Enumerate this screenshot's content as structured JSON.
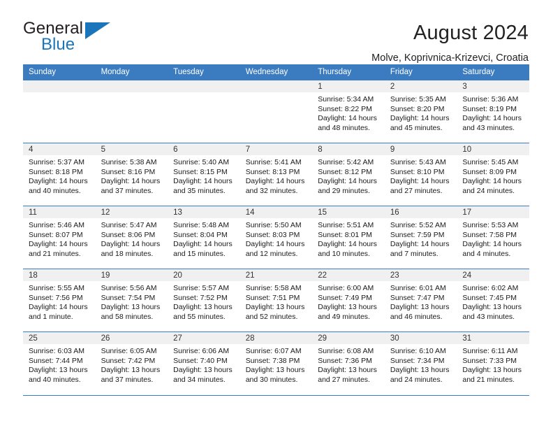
{
  "brand": {
    "name_part1": "General",
    "name_part2": "Blue",
    "triangle_color": "#1b75bb"
  },
  "header": {
    "title": "August 2024",
    "subtitle": "Molve, Koprivnica-Krizevci, Croatia"
  },
  "theme": {
    "header_row_bg": "#3b7cc0",
    "daynum_bg": "#f0f0f0",
    "grid_line": "#3b7cc0"
  },
  "weekday_headers": [
    "Sunday",
    "Monday",
    "Tuesday",
    "Wednesday",
    "Thursday",
    "Friday",
    "Saturday"
  ],
  "weeks": [
    [
      {
        "day": "",
        "sunrise": "",
        "sunset": "",
        "daylight1": "",
        "daylight2": ""
      },
      {
        "day": "",
        "sunrise": "",
        "sunset": "",
        "daylight1": "",
        "daylight2": ""
      },
      {
        "day": "",
        "sunrise": "",
        "sunset": "",
        "daylight1": "",
        "daylight2": ""
      },
      {
        "day": "",
        "sunrise": "",
        "sunset": "",
        "daylight1": "",
        "daylight2": ""
      },
      {
        "day": "1",
        "sunrise": "Sunrise: 5:34 AM",
        "sunset": "Sunset: 8:22 PM",
        "daylight1": "Daylight: 14 hours",
        "daylight2": "and 48 minutes."
      },
      {
        "day": "2",
        "sunrise": "Sunrise: 5:35 AM",
        "sunset": "Sunset: 8:20 PM",
        "daylight1": "Daylight: 14 hours",
        "daylight2": "and 45 minutes."
      },
      {
        "day": "3",
        "sunrise": "Sunrise: 5:36 AM",
        "sunset": "Sunset: 8:19 PM",
        "daylight1": "Daylight: 14 hours",
        "daylight2": "and 43 minutes."
      }
    ],
    [
      {
        "day": "4",
        "sunrise": "Sunrise: 5:37 AM",
        "sunset": "Sunset: 8:18 PM",
        "daylight1": "Daylight: 14 hours",
        "daylight2": "and 40 minutes."
      },
      {
        "day": "5",
        "sunrise": "Sunrise: 5:38 AM",
        "sunset": "Sunset: 8:16 PM",
        "daylight1": "Daylight: 14 hours",
        "daylight2": "and 37 minutes."
      },
      {
        "day": "6",
        "sunrise": "Sunrise: 5:40 AM",
        "sunset": "Sunset: 8:15 PM",
        "daylight1": "Daylight: 14 hours",
        "daylight2": "and 35 minutes."
      },
      {
        "day": "7",
        "sunrise": "Sunrise: 5:41 AM",
        "sunset": "Sunset: 8:13 PM",
        "daylight1": "Daylight: 14 hours",
        "daylight2": "and 32 minutes."
      },
      {
        "day": "8",
        "sunrise": "Sunrise: 5:42 AM",
        "sunset": "Sunset: 8:12 PM",
        "daylight1": "Daylight: 14 hours",
        "daylight2": "and 29 minutes."
      },
      {
        "day": "9",
        "sunrise": "Sunrise: 5:43 AM",
        "sunset": "Sunset: 8:10 PM",
        "daylight1": "Daylight: 14 hours",
        "daylight2": "and 27 minutes."
      },
      {
        "day": "10",
        "sunrise": "Sunrise: 5:45 AM",
        "sunset": "Sunset: 8:09 PM",
        "daylight1": "Daylight: 14 hours",
        "daylight2": "and 24 minutes."
      }
    ],
    [
      {
        "day": "11",
        "sunrise": "Sunrise: 5:46 AM",
        "sunset": "Sunset: 8:07 PM",
        "daylight1": "Daylight: 14 hours",
        "daylight2": "and 21 minutes."
      },
      {
        "day": "12",
        "sunrise": "Sunrise: 5:47 AM",
        "sunset": "Sunset: 8:06 PM",
        "daylight1": "Daylight: 14 hours",
        "daylight2": "and 18 minutes."
      },
      {
        "day": "13",
        "sunrise": "Sunrise: 5:48 AM",
        "sunset": "Sunset: 8:04 PM",
        "daylight1": "Daylight: 14 hours",
        "daylight2": "and 15 minutes."
      },
      {
        "day": "14",
        "sunrise": "Sunrise: 5:50 AM",
        "sunset": "Sunset: 8:03 PM",
        "daylight1": "Daylight: 14 hours",
        "daylight2": "and 12 minutes."
      },
      {
        "day": "15",
        "sunrise": "Sunrise: 5:51 AM",
        "sunset": "Sunset: 8:01 PM",
        "daylight1": "Daylight: 14 hours",
        "daylight2": "and 10 minutes."
      },
      {
        "day": "16",
        "sunrise": "Sunrise: 5:52 AM",
        "sunset": "Sunset: 7:59 PM",
        "daylight1": "Daylight: 14 hours",
        "daylight2": "and 7 minutes."
      },
      {
        "day": "17",
        "sunrise": "Sunrise: 5:53 AM",
        "sunset": "Sunset: 7:58 PM",
        "daylight1": "Daylight: 14 hours",
        "daylight2": "and 4 minutes."
      }
    ],
    [
      {
        "day": "18",
        "sunrise": "Sunrise: 5:55 AM",
        "sunset": "Sunset: 7:56 PM",
        "daylight1": "Daylight: 14 hours",
        "daylight2": "and 1 minute."
      },
      {
        "day": "19",
        "sunrise": "Sunrise: 5:56 AM",
        "sunset": "Sunset: 7:54 PM",
        "daylight1": "Daylight: 13 hours",
        "daylight2": "and 58 minutes."
      },
      {
        "day": "20",
        "sunrise": "Sunrise: 5:57 AM",
        "sunset": "Sunset: 7:52 PM",
        "daylight1": "Daylight: 13 hours",
        "daylight2": "and 55 minutes."
      },
      {
        "day": "21",
        "sunrise": "Sunrise: 5:58 AM",
        "sunset": "Sunset: 7:51 PM",
        "daylight1": "Daylight: 13 hours",
        "daylight2": "and 52 minutes."
      },
      {
        "day": "22",
        "sunrise": "Sunrise: 6:00 AM",
        "sunset": "Sunset: 7:49 PM",
        "daylight1": "Daylight: 13 hours",
        "daylight2": "and 49 minutes."
      },
      {
        "day": "23",
        "sunrise": "Sunrise: 6:01 AM",
        "sunset": "Sunset: 7:47 PM",
        "daylight1": "Daylight: 13 hours",
        "daylight2": "and 46 minutes."
      },
      {
        "day": "24",
        "sunrise": "Sunrise: 6:02 AM",
        "sunset": "Sunset: 7:45 PM",
        "daylight1": "Daylight: 13 hours",
        "daylight2": "and 43 minutes."
      }
    ],
    [
      {
        "day": "25",
        "sunrise": "Sunrise: 6:03 AM",
        "sunset": "Sunset: 7:44 PM",
        "daylight1": "Daylight: 13 hours",
        "daylight2": "and 40 minutes."
      },
      {
        "day": "26",
        "sunrise": "Sunrise: 6:05 AM",
        "sunset": "Sunset: 7:42 PM",
        "daylight1": "Daylight: 13 hours",
        "daylight2": "and 37 minutes."
      },
      {
        "day": "27",
        "sunrise": "Sunrise: 6:06 AM",
        "sunset": "Sunset: 7:40 PM",
        "daylight1": "Daylight: 13 hours",
        "daylight2": "and 34 minutes."
      },
      {
        "day": "28",
        "sunrise": "Sunrise: 6:07 AM",
        "sunset": "Sunset: 7:38 PM",
        "daylight1": "Daylight: 13 hours",
        "daylight2": "and 30 minutes."
      },
      {
        "day": "29",
        "sunrise": "Sunrise: 6:08 AM",
        "sunset": "Sunset: 7:36 PM",
        "daylight1": "Daylight: 13 hours",
        "daylight2": "and 27 minutes."
      },
      {
        "day": "30",
        "sunrise": "Sunrise: 6:10 AM",
        "sunset": "Sunset: 7:34 PM",
        "daylight1": "Daylight: 13 hours",
        "daylight2": "and 24 minutes."
      },
      {
        "day": "31",
        "sunrise": "Sunrise: 6:11 AM",
        "sunset": "Sunset: 7:33 PM",
        "daylight1": "Daylight: 13 hours",
        "daylight2": "and 21 minutes."
      }
    ]
  ]
}
